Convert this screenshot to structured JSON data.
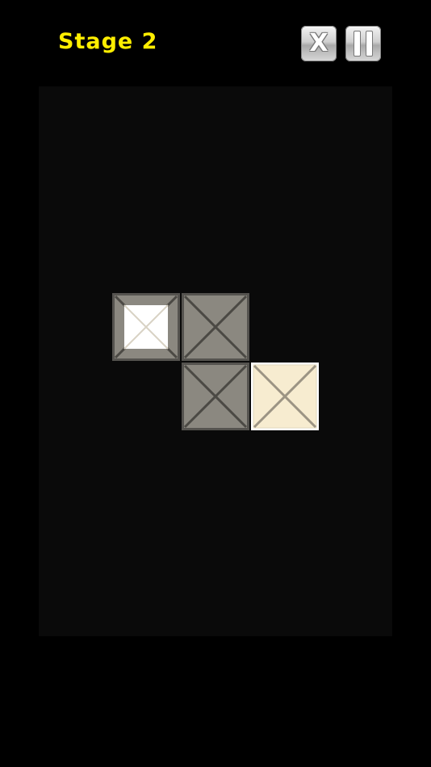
{
  "header": {
    "stage_label": "Stage 2",
    "close_button_label": "X"
  },
  "icons": {
    "close": "close-icon",
    "pause": "pause-icon"
  },
  "board": {
    "tiles": [
      {
        "row": 0,
        "col": 0,
        "state": "lit-center"
      },
      {
        "row": 0,
        "col": 1,
        "state": "unlit"
      },
      {
        "row": 1,
        "col": 1,
        "state": "unlit"
      },
      {
        "row": 1,
        "col": 2,
        "state": "lit"
      }
    ]
  },
  "colors": {
    "stage_text": "#ffee00",
    "board_bg": "#0a0a0a",
    "tile_unlit": "#8e8b84",
    "tile_lit": "#fbf3dc"
  }
}
